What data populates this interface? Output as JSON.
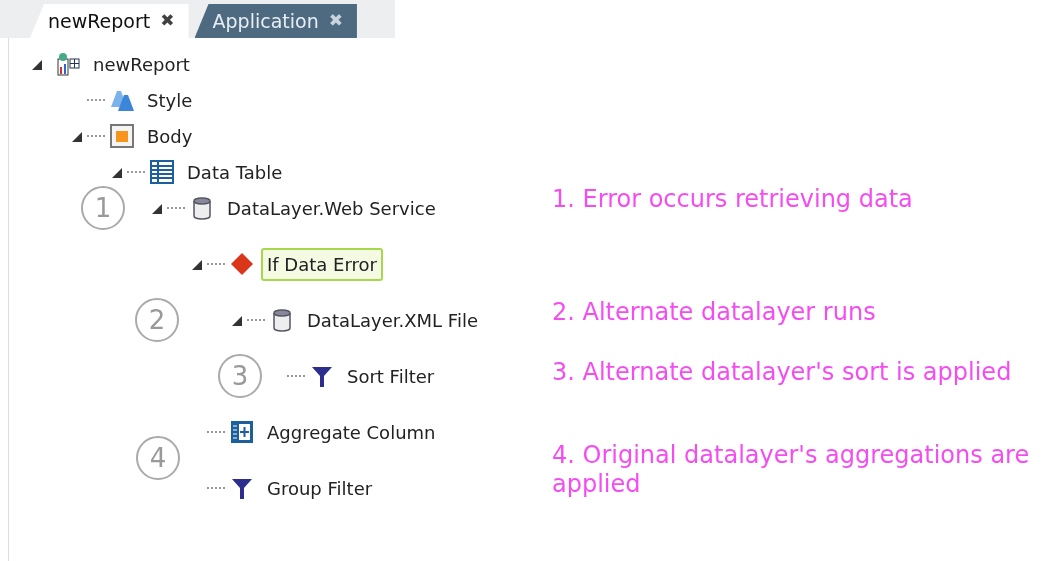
{
  "tabs": [
    {
      "label": "newReport",
      "close": "✖",
      "selected": true
    },
    {
      "label": "Application",
      "close": "✖",
      "selected": false
    }
  ],
  "tree": [
    {
      "label": "newReport",
      "kind": "report",
      "expanded": true,
      "selected": false,
      "children": [
        {
          "label": "Style",
          "kind": "style",
          "selected": false
        },
        {
          "label": "Body",
          "kind": "body",
          "expanded": true,
          "selected": false,
          "children": [
            {
              "label": "Data Table",
              "kind": "table",
              "expanded": true,
              "selected": false,
              "children": [
                {
                  "label": "DataLayer.Web Service",
                  "kind": "db",
                  "expanded": true,
                  "selected": false,
                  "children": [
                    {
                      "label": "If Data Error",
                      "kind": "diamond",
                      "expanded": true,
                      "selected": true,
                      "children": [
                        {
                          "label": "DataLayer.XML File",
                          "kind": "db",
                          "expanded": true,
                          "selected": false,
                          "children": [
                            {
                              "label": "Sort Filter",
                              "kind": "filter",
                              "selected": false
                            }
                          ]
                        }
                      ]
                    },
                    {
                      "label": "Aggregate Column",
                      "kind": "aggregate",
                      "selected": false
                    },
                    {
                      "label": "Group Filter",
                      "kind": "filter",
                      "selected": false
                    }
                  ]
                }
              ]
            }
          ]
        }
      ]
    }
  ],
  "callouts": [
    {
      "number": "1",
      "text": "1. Error occurs retrieving data"
    },
    {
      "number": "2",
      "text": "2. Alternate datalayer runs"
    },
    {
      "number": "3",
      "text": "3. Alternate datalayer's sort is applied"
    },
    {
      "number": "4",
      "text": "4. Original datalayer's aggregations are applied"
    }
  ]
}
